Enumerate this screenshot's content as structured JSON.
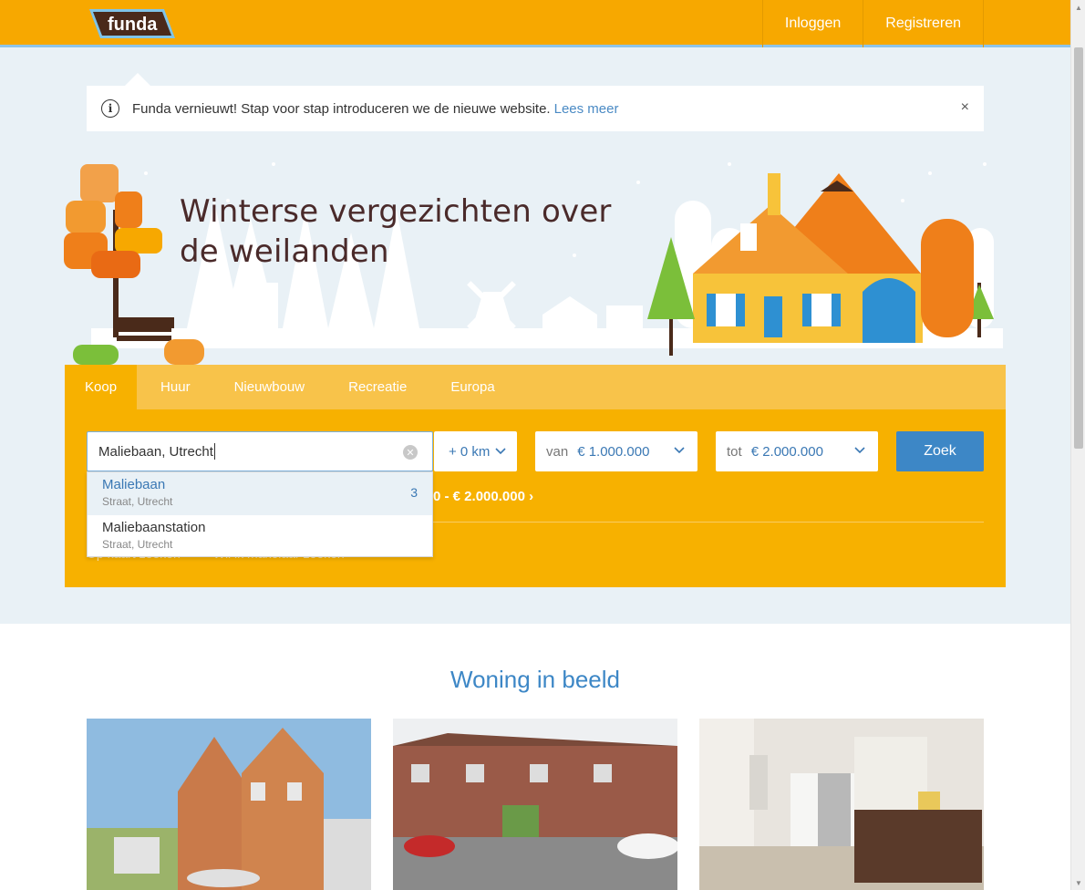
{
  "header": {
    "logo_text": "funda",
    "login_label": "Inloggen",
    "register_label": "Registreren"
  },
  "notice": {
    "text": "Funda vernieuwt! Stap voor stap introduceren we de nieuwe website.",
    "link_label": "Lees meer",
    "close_label": "×"
  },
  "hero": {
    "title": "Winterse vergezichten over de weilanden"
  },
  "search": {
    "tabs": [
      {
        "label": "Koop",
        "active": true
      },
      {
        "label": "Huur"
      },
      {
        "label": "Nieuwbouw"
      },
      {
        "label": "Recreatie"
      },
      {
        "label": "Europa"
      }
    ],
    "location_value": "Maliebaan, Utrecht",
    "radius_value": "+ 0 km",
    "price_from_label": "van",
    "price_from_value": "€ 1.000.000",
    "price_to_label": "tot",
    "price_to_value": "€ 2.000.000",
    "submit_label": "Zoek",
    "summary_text": "0 - € 2.000.000",
    "bottom_links": [
      "Op kaart zoeken",
      "Wil ik makelaar zoeken"
    ]
  },
  "autocomplete": {
    "items": [
      {
        "name": "Maliebaan",
        "sub": "Straat, Utrecht",
        "count": "3"
      },
      {
        "name": "Maliebaanstation",
        "sub": "Straat, Utrecht",
        "count": ""
      }
    ]
  },
  "section": {
    "title": "Woning in beeld"
  },
  "colors": {
    "brand_orange": "#f7a800",
    "accent_blue": "#3d87c6",
    "background_light": "#e9f1f6"
  }
}
